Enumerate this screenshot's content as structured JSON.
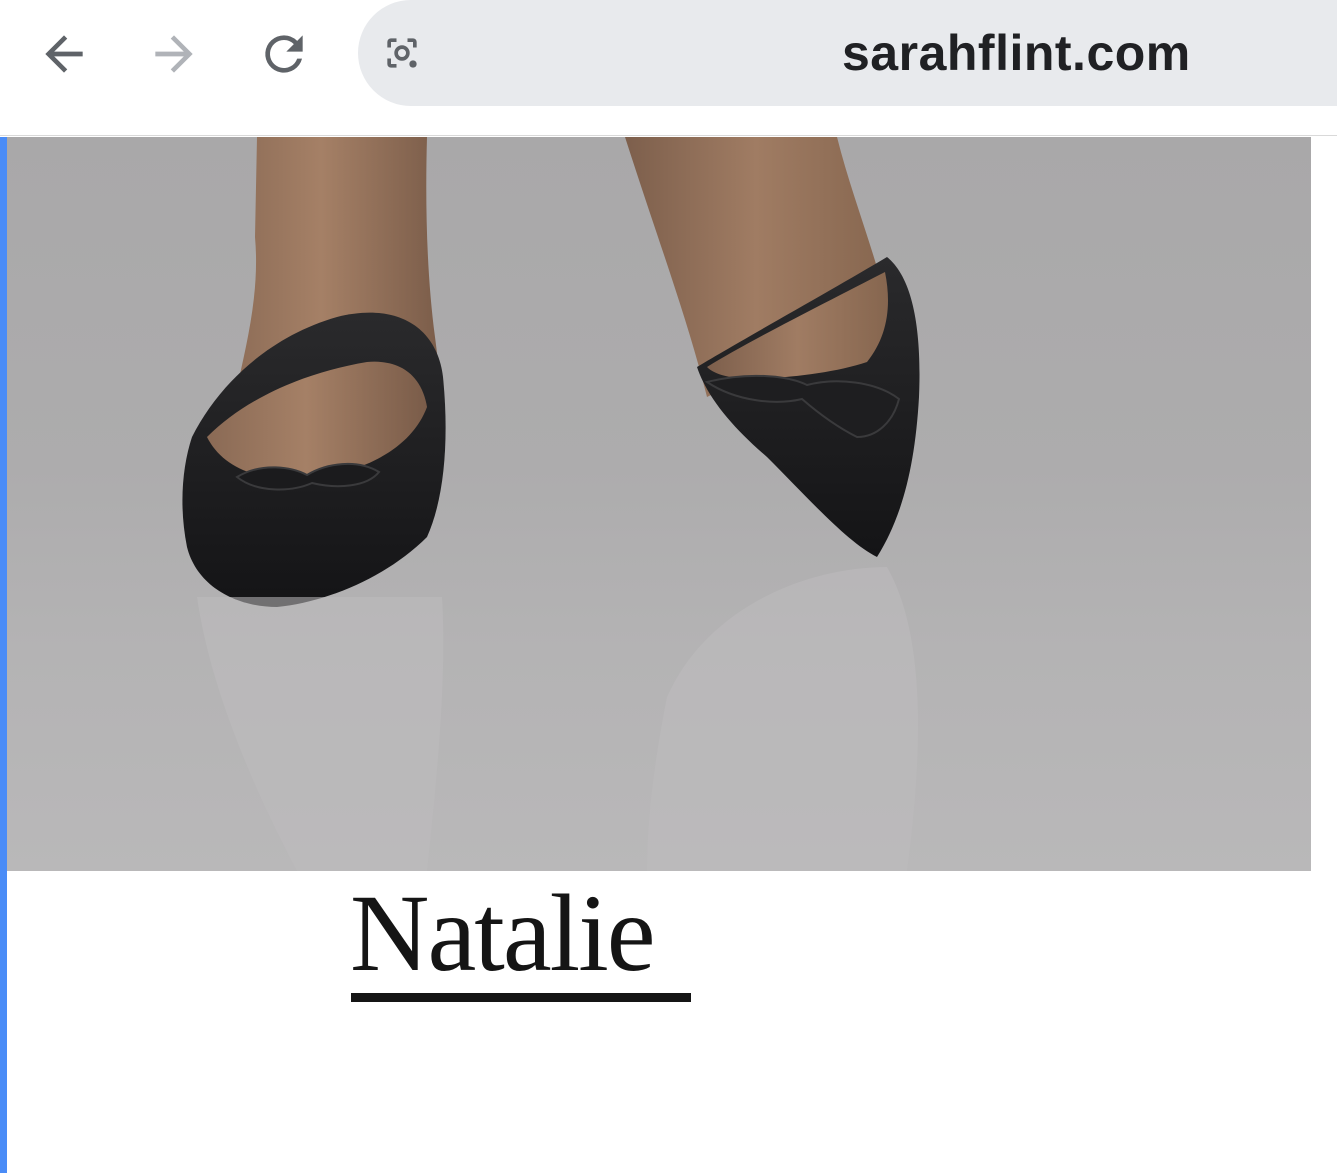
{
  "browser": {
    "url": "sarahflint.com",
    "back_icon": "arrow-left-icon",
    "forward_icon": "arrow-right-icon",
    "reload_icon": "reload-icon",
    "lens_icon": "google-lens-icon"
  },
  "product": {
    "title": "Natalie"
  },
  "colors": {
    "accent_bar": "#4a8cf7",
    "omnibox_bg": "#e8eaed",
    "hero_bg": "#adacad",
    "title_color": "#151515"
  }
}
